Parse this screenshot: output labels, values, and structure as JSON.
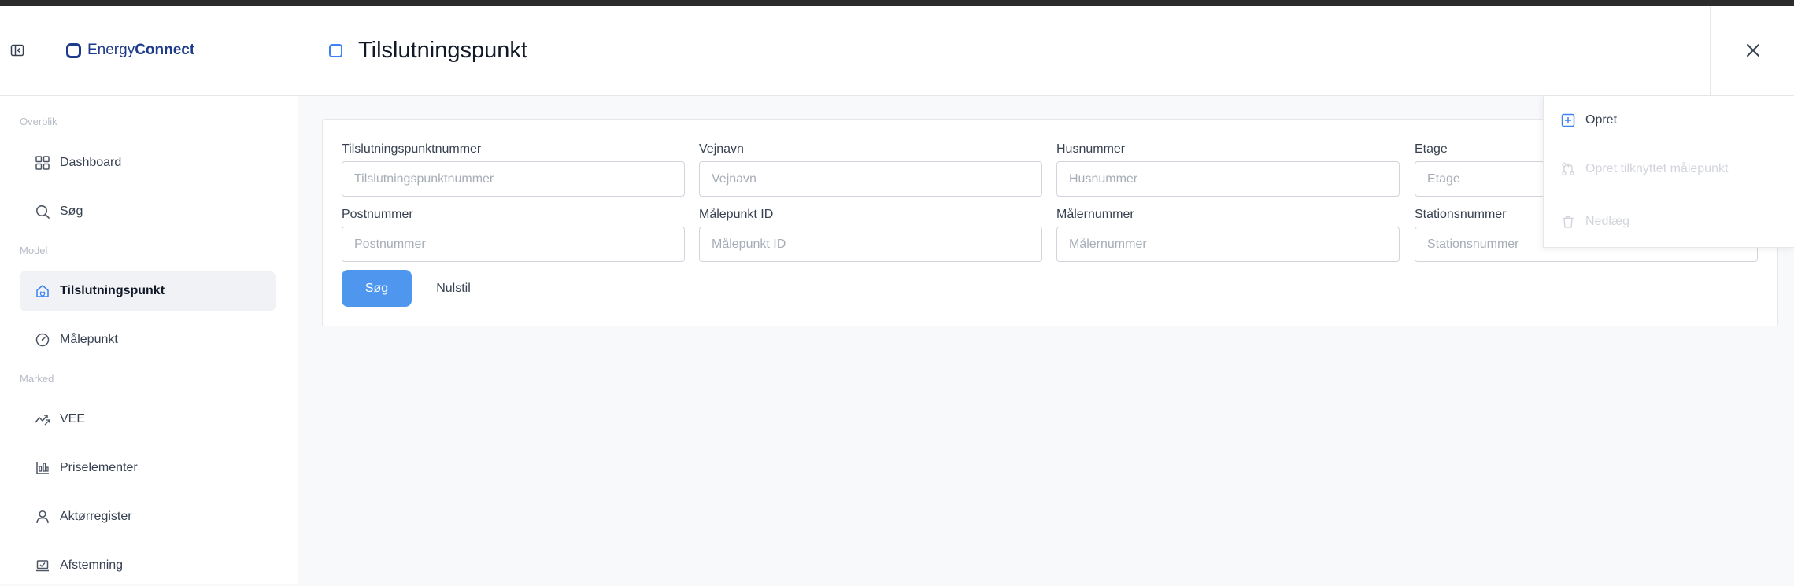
{
  "app": {
    "brand_part1": "Energy",
    "brand_part2": "Connect",
    "page_title": "Tilslutningspunkt"
  },
  "sidebar": {
    "sections": [
      {
        "label": "Overblik",
        "items": [
          {
            "label": "Dashboard",
            "icon": "grid-icon"
          },
          {
            "label": "Søg",
            "icon": "search-icon"
          }
        ]
      },
      {
        "label": "Model",
        "items": [
          {
            "label": "Tilslutningspunkt",
            "icon": "house-plug-icon",
            "active": true
          },
          {
            "label": "Målepunkt",
            "icon": "gauge-icon"
          }
        ]
      },
      {
        "label": "Marked",
        "items": [
          {
            "label": "VEE",
            "icon": "trend-icon"
          },
          {
            "label": "Priselementer",
            "icon": "price-chart-icon"
          },
          {
            "label": "Aktørregister",
            "icon": "user-icon"
          },
          {
            "label": "Afstemning",
            "icon": "laptop-check-icon"
          }
        ]
      }
    ]
  },
  "search_form": {
    "fields": [
      {
        "label": "Tilslutningspunktnummer",
        "placeholder": "Tilslutningspunktnummer",
        "value": ""
      },
      {
        "label": "Vejnavn",
        "placeholder": "Vejnavn",
        "value": ""
      },
      {
        "label": "Husnummer",
        "placeholder": "Husnummer",
        "value": ""
      },
      {
        "label": "Etage",
        "placeholder": "Etage",
        "value": ""
      },
      {
        "label": "Postnummer",
        "placeholder": "Postnummer",
        "value": ""
      },
      {
        "label": "Målepunkt ID",
        "placeholder": "Målepunkt ID",
        "value": ""
      },
      {
        "label": "Målernummer",
        "placeholder": "Målernummer",
        "value": ""
      },
      {
        "label": "Stationsnummer",
        "placeholder": "Stationsnummer",
        "value": ""
      }
    ],
    "search_label": "Søg",
    "reset_label": "Nulstil"
  },
  "action_menu": {
    "items": [
      {
        "label": "Opret",
        "icon": "plus-square-icon",
        "enabled": true
      },
      {
        "label": "Opret tilknyttet målepunkt",
        "icon": "git-pull-icon",
        "enabled": false
      },
      {
        "label": "Nedlæg",
        "icon": "trash-icon",
        "enabled": false
      }
    ]
  },
  "colors": {
    "primary": "#4f97ee",
    "brand": "#1e3a8a",
    "active_bg": "#f1f2f5"
  }
}
